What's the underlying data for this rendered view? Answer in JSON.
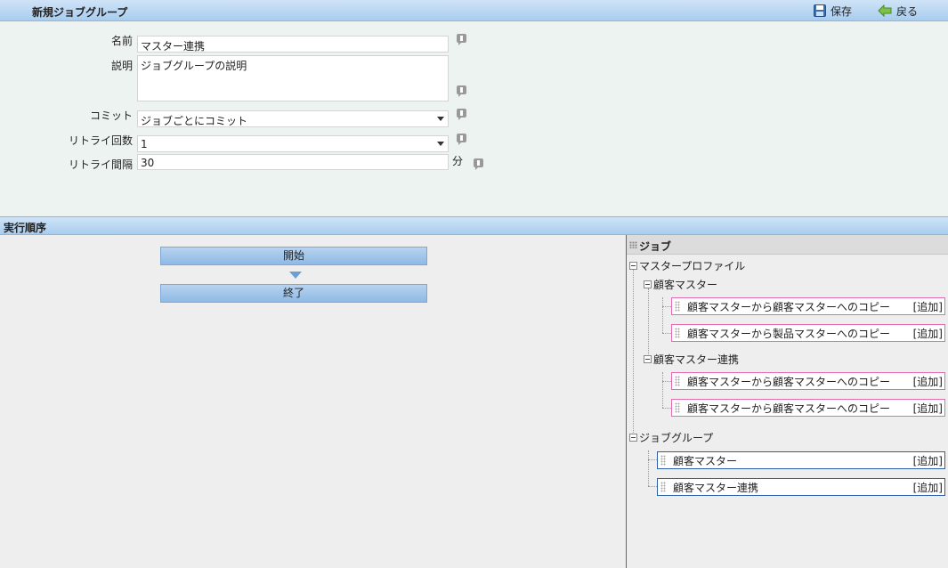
{
  "window": {
    "title": "新規ジョブグループ",
    "save_label": "保存",
    "back_label": "戻る"
  },
  "form": {
    "name_label": "名前",
    "name_value": "マスター連携",
    "desc_label": "説明",
    "desc_value": "ジョブグループの説明",
    "commit_label": "コミット",
    "commit_value": "ジョブごとにコミット",
    "retry_count_label": "リトライ回数",
    "retry_count_value": "1",
    "retry_interval_label": "リトライ間隔",
    "retry_interval_value": "30",
    "retry_interval_unit": "分"
  },
  "execution": {
    "title": "実行順序",
    "start_label": "開始",
    "end_label": "終了"
  },
  "jobs": {
    "title": "ジョブ",
    "profile_group": "マスタープロファイル",
    "customer_master": "顧客マスター",
    "customer_master_jobs": [
      "顧客マスターから顧客マスターへのコピー",
      "顧客マスターから製品マスターへのコピー"
    ],
    "customer_master_link": "顧客マスター連携",
    "customer_master_link_jobs": [
      "顧客マスターから顧客マスターへのコピー",
      "顧客マスターから顧客マスターへのコピー"
    ],
    "jobgroup_group": "ジョブグループ",
    "jobgroups": [
      "顧客マスター",
      "顧客マスター連携"
    ],
    "add_label": "[追加]"
  },
  "colors": {
    "header_blue": "#a9cdee",
    "pink_border": "#e36bb0",
    "blue_border": "#2d5fa8"
  }
}
